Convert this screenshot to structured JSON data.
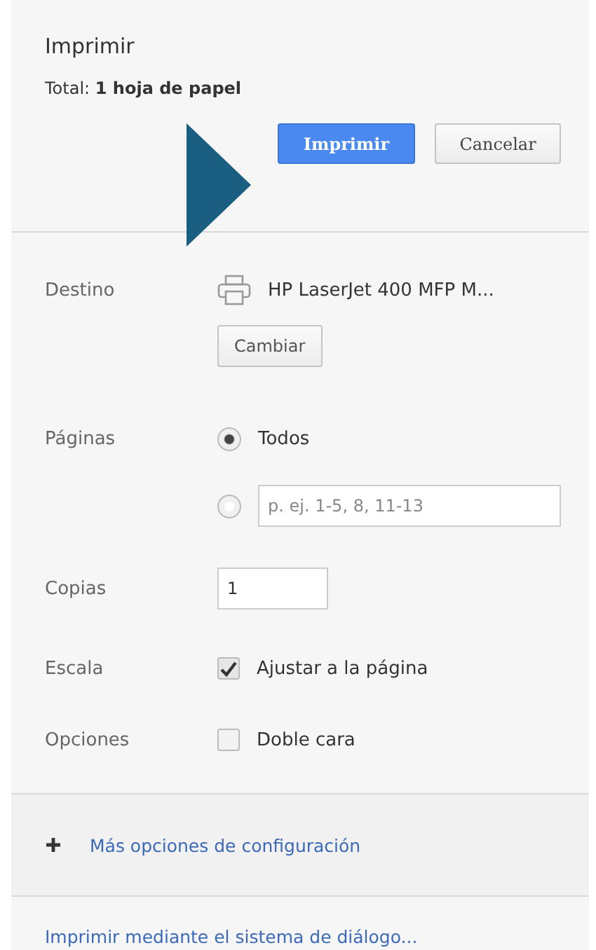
{
  "title": "Imprimir",
  "total": "Total: **1 hoja de papel**",
  "buttons": [
    {
      "label": "Imprimir",
      "kind": "primary"
    },
    {
      "label": "Cancelar",
      "kind": "secondary"
    }
  ],
  "destination": {
    "label": "Destino",
    "printer": "HP LaserJet 400 MFP M...",
    "change_button": "Cambiar"
  },
  "pages": {
    "label": "Páginas",
    "options": [
      {
        "kind": "all",
        "label": "Todos",
        "selected": true
      },
      {
        "kind": "range",
        "placeholder": "p. ej. 1-5, 8, 11-13",
        "selected": false
      }
    ]
  },
  "copies": {
    "label": "Copias",
    "value": "1"
  },
  "scale": {
    "label": "Escala",
    "option": "Ajustar a la página",
    "checked": true
  },
  "options": {
    "label": "Opciones",
    "option": "Doble cara",
    "checked": false
  },
  "more_settings": "Más opciones de configuración",
  "system_dialog_link": "Imprimir mediante el sistema de diálogo..."
}
